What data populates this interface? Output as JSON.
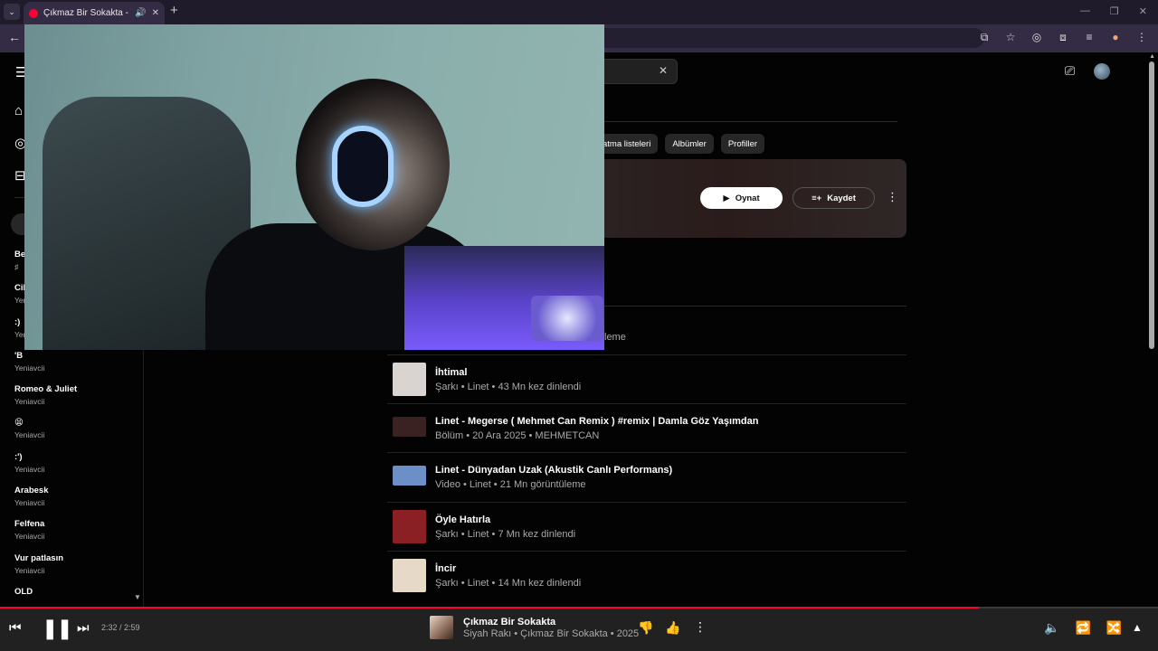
{
  "browser": {
    "tab_title": "Çıkmaz Bir Sokakta - YouTube Music",
    "new_tab_glyph": "+",
    "toolbar_icons": [
      "install-app-icon",
      "star-icon",
      "incognito-icon",
      "extensions-icon",
      "reading-list-icon",
      "extension-badge-icon",
      "kebab-menu-icon"
    ]
  },
  "search": {
    "clear_glyph": "✕"
  },
  "chips": [
    "atma listeleri",
    "Albümler",
    "Profiller"
  ],
  "top_card": {
    "play_label": "Oynat",
    "save_label": "Kaydet"
  },
  "partial_subtitle": "leme",
  "sidebar": {
    "playlists": [
      {
        "title": "Be",
        "subtitle": "♯"
      },
      {
        "title": "Cil",
        "subtitle": "Yeni"
      },
      {
        "title": ":)",
        "subtitle": "Yeni"
      },
      {
        "title": "'B",
        "subtitle": "Yeniavcii"
      },
      {
        "title": "Romeo & Juliet",
        "subtitle": "Yeniavcii"
      },
      {
        "title": "😫",
        "subtitle": "Yeniavcii"
      },
      {
        "title": ":')",
        "subtitle": "Yeniavcii"
      },
      {
        "title": "Arabesk",
        "subtitle": "Yeniavcii"
      },
      {
        "title": "Felfena",
        "subtitle": "Yeniavcii"
      },
      {
        "title": "Vur patlasın",
        "subtitle": "Yeniavcii"
      },
      {
        "title": "OLD",
        "subtitle": ""
      }
    ]
  },
  "results": [
    {
      "title": "İhtimal",
      "subtitle": "Şarkı • Linet • 43 Mn kez dinlendi",
      "thumb_color": "#d9d4d0"
    },
    {
      "title": "Linet - Megerse ( Mehmet Can Remix ) #remix | Damla Göz Yaşımdan",
      "subtitle": "Bölüm • 20 Ara 2025 • MEHMETCAN",
      "thumb_color": "#3a2222"
    },
    {
      "title": "Linet - Dünyadan Uzak (Akustik Canlı Performans)",
      "subtitle": "Video • Linet • 21 Mn görüntüleme",
      "thumb_color": "#6d8fc7"
    },
    {
      "title": "Öyle Hatırla",
      "subtitle": "Şarkı • Linet • 7 Mn kez dinlendi",
      "thumb_color": "#8a1f24"
    },
    {
      "title": "İncir",
      "subtitle": "Şarkı • Linet • 14 Mn kez dinlendi",
      "thumb_color": "#e7d9c7"
    }
  ],
  "player": {
    "time": "2:32 / 2:59",
    "progress_fraction": 0.845,
    "title": "Çıkmaz Bir Sokakta",
    "subtitle": "Siyah Rakı • Çıkmaz Bir Sokakta • 2025",
    "accent": "#ff0033"
  }
}
